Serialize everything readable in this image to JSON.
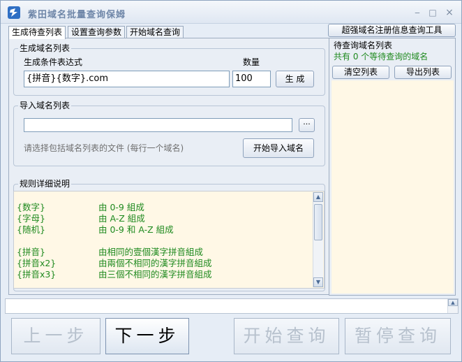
{
  "window": {
    "title": "紫田域名批量查询保姆",
    "min_glyph": "‒",
    "max_glyph": "□",
    "close_glyph": "×"
  },
  "tabs": [
    {
      "label": "生成待查列表",
      "active": true
    },
    {
      "label": "设置查询参数",
      "active": false
    },
    {
      "label": "开始域名查询",
      "active": false
    }
  ],
  "generate": {
    "group_title": "生成域名列表",
    "expr_label": "生成条件表达式",
    "expr_value": "{拼音}{数字}.com",
    "count_label": "数量",
    "count_value": "100",
    "generate_button": "生 成"
  },
  "import": {
    "group_title": "导入域名列表",
    "file_value": "",
    "browse_button": "···",
    "hint": "请选择包括域名列表的文件 (每行一个域名)",
    "import_button": "开始导入域名"
  },
  "rules": {
    "group_title": "规则详细说明",
    "items": [
      {
        "key": "{数字}",
        "desc": "由 0-9 組成"
      },
      {
        "key": "{字母}",
        "desc": "由 A-Z 組成"
      },
      {
        "key": "{随机}",
        "desc": "由 0-9 和 A-Z 組成"
      },
      {
        "key": "{拼音}",
        "desc": "由相同的壹個漢字拼音組成"
      },
      {
        "key": "{拼音x2}",
        "desc": "由兩個不相同的漢字拼音組成"
      },
      {
        "key": "{拼音x3}",
        "desc": "由三個不相同的漢字拼音組成"
      }
    ]
  },
  "queue": {
    "whois_button": "超强域名注册信息查询工具",
    "group_title": "待查询域名列表",
    "count_text": "共有 0 个等待查询的域名",
    "clear_button": "清空列表",
    "export_button": "导出列表"
  },
  "status": {
    "text": ""
  },
  "nav": {
    "prev": "上一步",
    "next": "下一步",
    "start": "开始查询",
    "pause": "暂停查询"
  },
  "colors": {
    "accent_green": "#1f8a1f",
    "list_background": "#fff8e6",
    "title_text": "#6e86a8"
  },
  "icons": {
    "app": "app-logo-icon",
    "browse": "ellipsis-icon",
    "scroll_up": "arrow-up-icon",
    "scroll_down": "arrow-down-icon"
  }
}
